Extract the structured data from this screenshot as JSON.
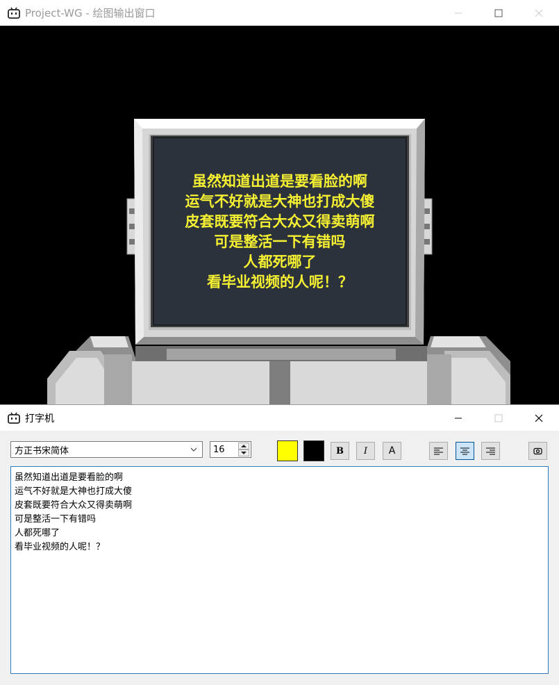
{
  "render_window": {
    "title": "Project-WG - 绘图输出窗口",
    "icon": "bilibili-tv-icon",
    "controls": [
      "minimize-icon",
      "maximize-icon",
      "close-icon"
    ],
    "screen_text": [
      "虽然知道出道是要看脸的啊",
      "运气不好就是大神也打成大傻",
      "皮套既要符合大众又得卖萌啊",
      "可是整活一下有错吗",
      "人都死哪了",
      "看毕业视频的人呢！？"
    ],
    "screen_text_color": "#f5f032"
  },
  "typewriter_window": {
    "title": "打字机",
    "icon": "bilibili-tv-icon",
    "controls": [
      "minimize-icon",
      "maximize-icon",
      "close-icon"
    ],
    "toolbar": {
      "font_family_value": "方正书宋简体",
      "font_size_value": "16",
      "text_color": "#ffff00",
      "background_color": "#000000",
      "bold_label": "B",
      "italic_label": "I",
      "font_label": "A",
      "align_selected": "center",
      "align_options": [
        "left",
        "center",
        "right"
      ],
      "preview_button_icon": "eye-icon"
    },
    "editor_lines": [
      "虽然知道出道是要看脸的啊",
      "运气不好就是大神也打成大傻",
      "皮套既要符合大众又得卖萌啊",
      "可是整活一下有错吗",
      "人都死哪了",
      "看毕业视频的人呢！？"
    ]
  }
}
